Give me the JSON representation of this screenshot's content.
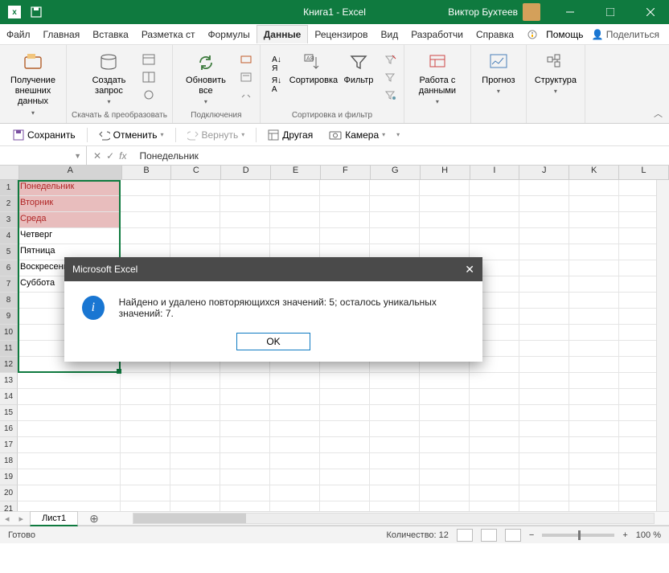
{
  "titlebar": {
    "title": "Книга1 - Excel",
    "user": "Виктор Бухтеев"
  },
  "menu": {
    "tabs": [
      "Файл",
      "Главная",
      "Вставка",
      "Разметка ст",
      "Формулы",
      "Данные",
      "Рецензиров",
      "Вид",
      "Разработчи",
      "Справка"
    ],
    "active_index": 5,
    "help": "Помощь",
    "share": "Поделиться"
  },
  "ribbon": {
    "group1": {
      "btn": "Получение внешних данных"
    },
    "group2": {
      "btn": "Создать запрос",
      "label": "Скачать & преобразовать"
    },
    "group3": {
      "btn": "Обновить все",
      "label": "Подключения"
    },
    "group4": {
      "sort": "Сортировка",
      "filter": "Фильтр",
      "label": "Сортировка и фильтр"
    },
    "group5": {
      "btn": "Работа с данными"
    },
    "group6": {
      "btn": "Прогноз"
    },
    "group7": {
      "btn": "Структура"
    }
  },
  "qat": {
    "save": "Сохранить",
    "undo": "Отменить",
    "redo": "Вернуть",
    "other": "Другая",
    "camera": "Камера"
  },
  "formula": {
    "value": "Понедельник",
    "fx": "fx"
  },
  "columns": [
    "A",
    "B",
    "C",
    "D",
    "E",
    "F",
    "G",
    "H",
    "I",
    "J",
    "K",
    "L"
  ],
  "rows_a": [
    "Понедельник",
    "Вторник",
    "Среда",
    "Четверг",
    "Пятница",
    "Воскресенье",
    "Суббота"
  ],
  "sheet": {
    "name": "Лист1"
  },
  "dialog": {
    "title": "Microsoft Excel",
    "message": "Найдено и удалено повторяющихся значений: 5; осталось уникальных значений: 7.",
    "ok": "OK"
  },
  "status": {
    "ready": "Готово",
    "count_label": "Количество:",
    "count": "12",
    "zoom": "100 %"
  }
}
